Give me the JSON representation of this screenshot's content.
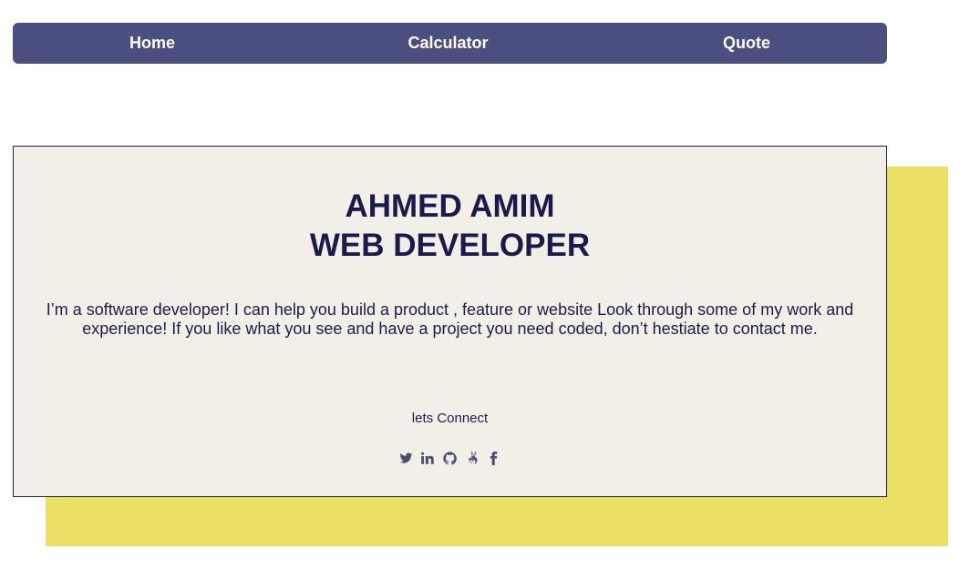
{
  "nav": {
    "items": [
      {
        "label": "Home"
      },
      {
        "label": "Calculator"
      },
      {
        "label": "Quote"
      }
    ]
  },
  "hero": {
    "name": "AHMED AMIM",
    "role": "WEB DEVELOPER",
    "bio": "I’m a software developer! I can help you build a product , feature or website Look through some of my work and experience! If you like what you see and have a project you need coded, don’t hestiate to contact me.",
    "connect_label": "lets Connect"
  },
  "socials": [
    {
      "icon": "twitter-icon"
    },
    {
      "icon": "linkedin-icon"
    },
    {
      "icon": "github-icon"
    },
    {
      "icon": "angellist-icon"
    },
    {
      "icon": "facebook-icon"
    }
  ],
  "colors": {
    "nav_bg": "#4b4f80",
    "card_bg": "#f2eee8",
    "accent_yellow": "#ebe066",
    "text_dark": "#1c1a4c"
  }
}
